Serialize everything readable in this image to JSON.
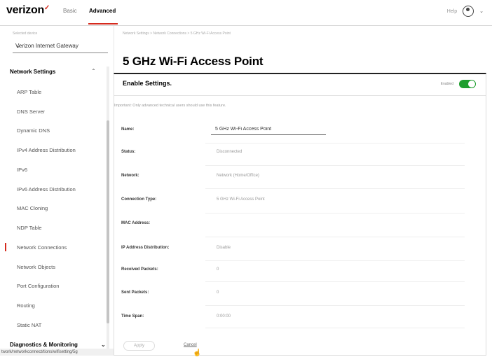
{
  "header": {
    "logo_text": "verizon",
    "logo_mark": "✓",
    "tabs": [
      {
        "label": "Basic",
        "active": false
      },
      {
        "label": "Advanced",
        "active": true
      }
    ],
    "help_label": "Help",
    "user_icon": "user-circle-icon",
    "accent_color": "#d52b1e"
  },
  "sidebar": {
    "device_label": "Selected device",
    "device_selected": "Verizon Internet Gateway",
    "sections": [
      {
        "title": "Network Settings",
        "expanded": true,
        "items": [
          "ARP Table",
          "DNS Server",
          "Dynamic DNS",
          "IPv4 Address Distribution",
          "IPv6",
          "IPv6 Address Distribution",
          "MAC Cloning",
          "NDP Table",
          "Network Connections",
          "Network Objects",
          "Port Configuration",
          "Routing",
          "Static NAT"
        ],
        "active_item": "Network Connections"
      },
      {
        "title": "Diagnostics & Monitoring",
        "expanded": false
      }
    ],
    "status_url": "twork/networkconnect/tions/wifisetting/5g"
  },
  "main": {
    "breadcrumb": "Network Settings  >  Network Connections  >  5 GHz Wi-Fi Access Point",
    "title": "5 GHz Wi-Fi Access Point",
    "card": {
      "title": "Enable Settings.",
      "toggle_label": "Enabled",
      "toggle_on": true,
      "note": "Important: Only advanced technical users should use this feature.",
      "fields": [
        {
          "label": "Name:",
          "value": "5 GHz Wi-Fi Access Point",
          "editable": true
        },
        {
          "label": "Status:",
          "value": "Disconnected"
        },
        {
          "label": "Network:",
          "value": "Network (Home/Office)"
        },
        {
          "label": "Connection Type:",
          "value": "5 GHz Wi-Fi Access Point"
        },
        {
          "label": "MAC Address:",
          "value": ""
        },
        {
          "label": "IP Address Distribution:",
          "value": "Disable"
        },
        {
          "label": "Received Packets:",
          "value": "0"
        },
        {
          "label": "Sent Packets:",
          "value": "0"
        },
        {
          "label": "Time Span:",
          "value": "0:00:00"
        }
      ]
    },
    "buttons": {
      "apply": "Apply",
      "cancel": "Cancel"
    },
    "toggle_color": "#1e9e2e"
  }
}
